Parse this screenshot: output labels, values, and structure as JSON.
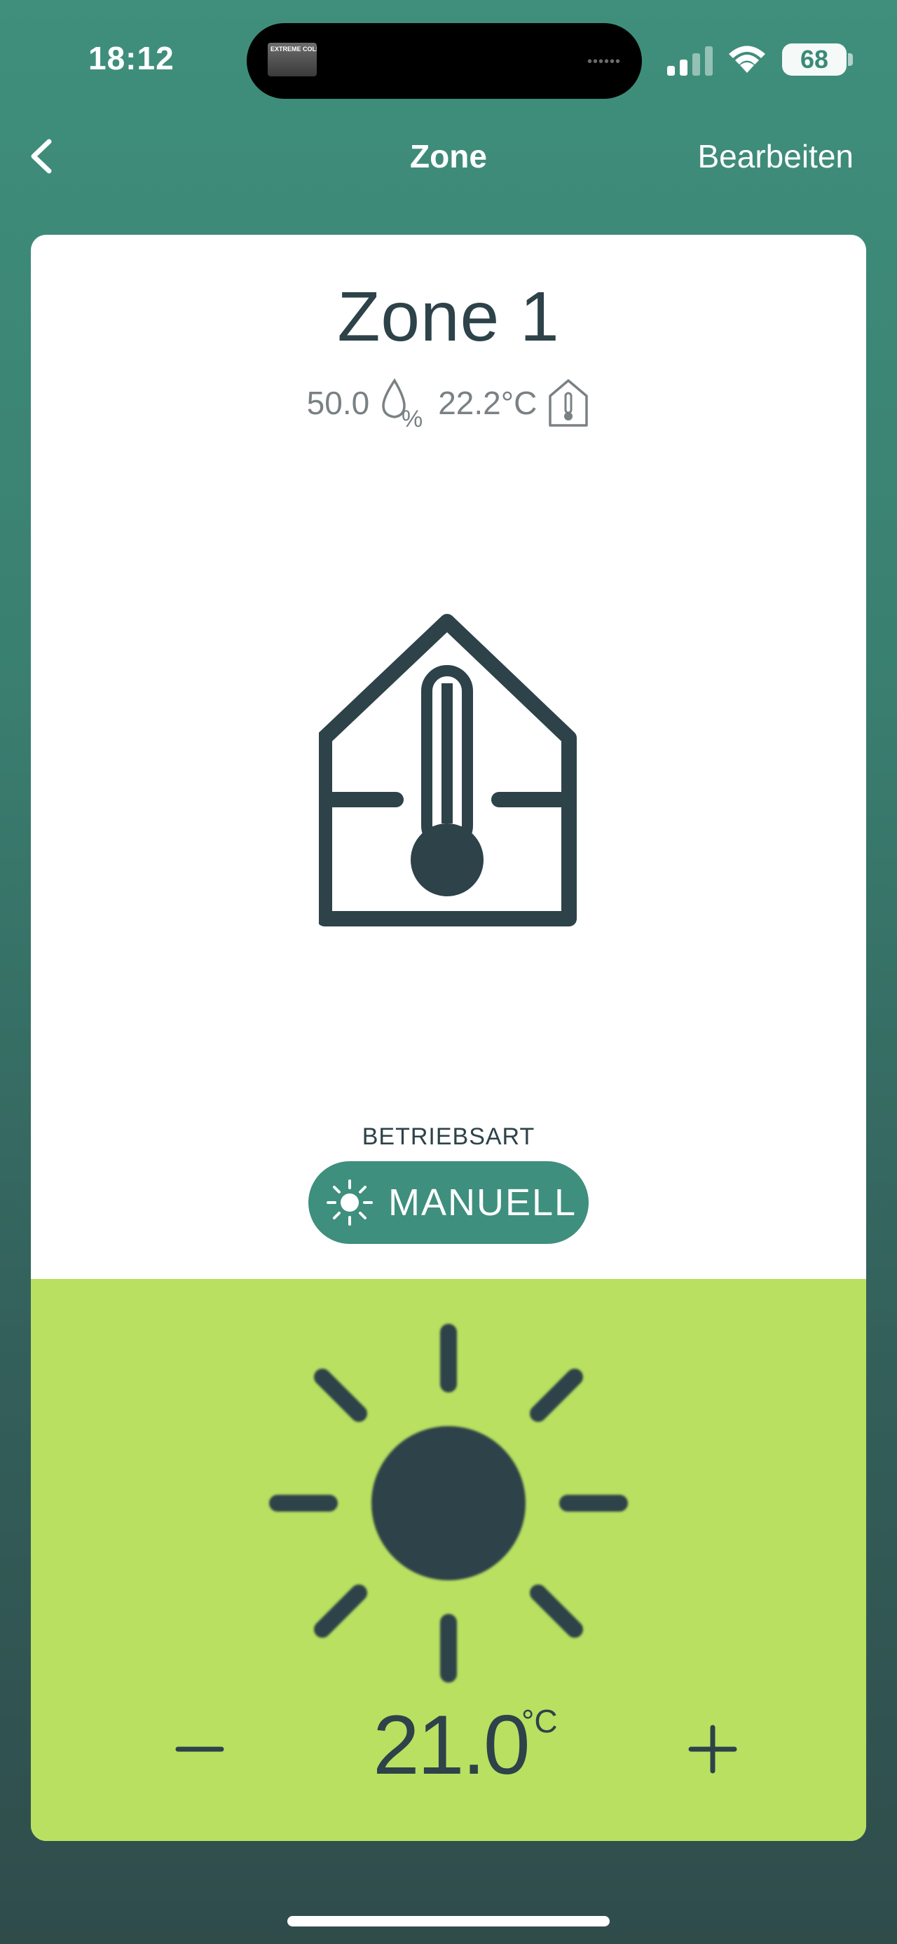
{
  "status_bar": {
    "time": "18:12",
    "live_activity_thumb_text": "EXTREME COLD",
    "battery_level": "68",
    "battery_fraction": 0.68,
    "icons": [
      "cellular-signal-icon",
      "wifi-icon",
      "battery-icon"
    ]
  },
  "nav": {
    "back_icon": "chevron-left-icon",
    "title": "Zone",
    "edit_label": "Bearbeiten"
  },
  "zone": {
    "name": "Zone 1",
    "humidity": "50.0",
    "humidity_icon": "humidity-drop-percent-icon",
    "temperature": "22.2°C",
    "temperature_icon": "house-thermometer-icon",
    "illustration_icon": "house-thermometer-icon"
  },
  "mode": {
    "label": "BETRIEBSART",
    "value": "MANUELL",
    "icon": "sun-icon"
  },
  "setpoint": {
    "icon": "sun-icon",
    "value": "21.0",
    "unit": "°C",
    "decrease_icon": "minus-icon",
    "increase_icon": "plus-icon"
  },
  "colors": {
    "accent": "#3e8f7d",
    "panel": "#b9e061",
    "text_dark": "#2d4249",
    "text_muted": "#7a8184"
  }
}
